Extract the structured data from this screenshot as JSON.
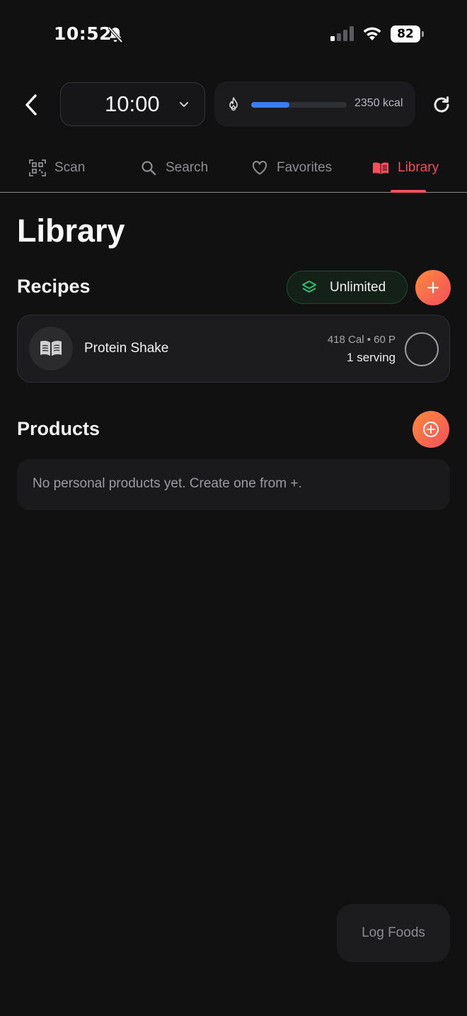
{
  "status_bar": {
    "time": "10:52",
    "battery_level": "82"
  },
  "header": {
    "time_value": "10:00",
    "calorie_target_label": "2350 kcal",
    "calorie_progress": 0.4,
    "progress_color": "#3a7df2"
  },
  "tabs": [
    {
      "label": "Scan",
      "icon": "qr-scan-icon",
      "active": false
    },
    {
      "label": "Search",
      "icon": "search-icon",
      "active": false
    },
    {
      "label": "Favorites",
      "icon": "heart-icon",
      "active": false
    },
    {
      "label": "Library",
      "icon": "book-icon",
      "active": true
    }
  ],
  "accent_color": "#f24f5c",
  "page": {
    "title": "Library",
    "recipes": {
      "title": "Recipes",
      "badge_label": "Unlimited",
      "items": [
        {
          "name": "Protein Shake",
          "macros": "418 Cal • 60 P",
          "serving": "1 serving"
        }
      ]
    },
    "products": {
      "title": "Products",
      "empty_text": "No personal products yet. Create one from +."
    }
  },
  "log_foods_label": "Log Foods"
}
